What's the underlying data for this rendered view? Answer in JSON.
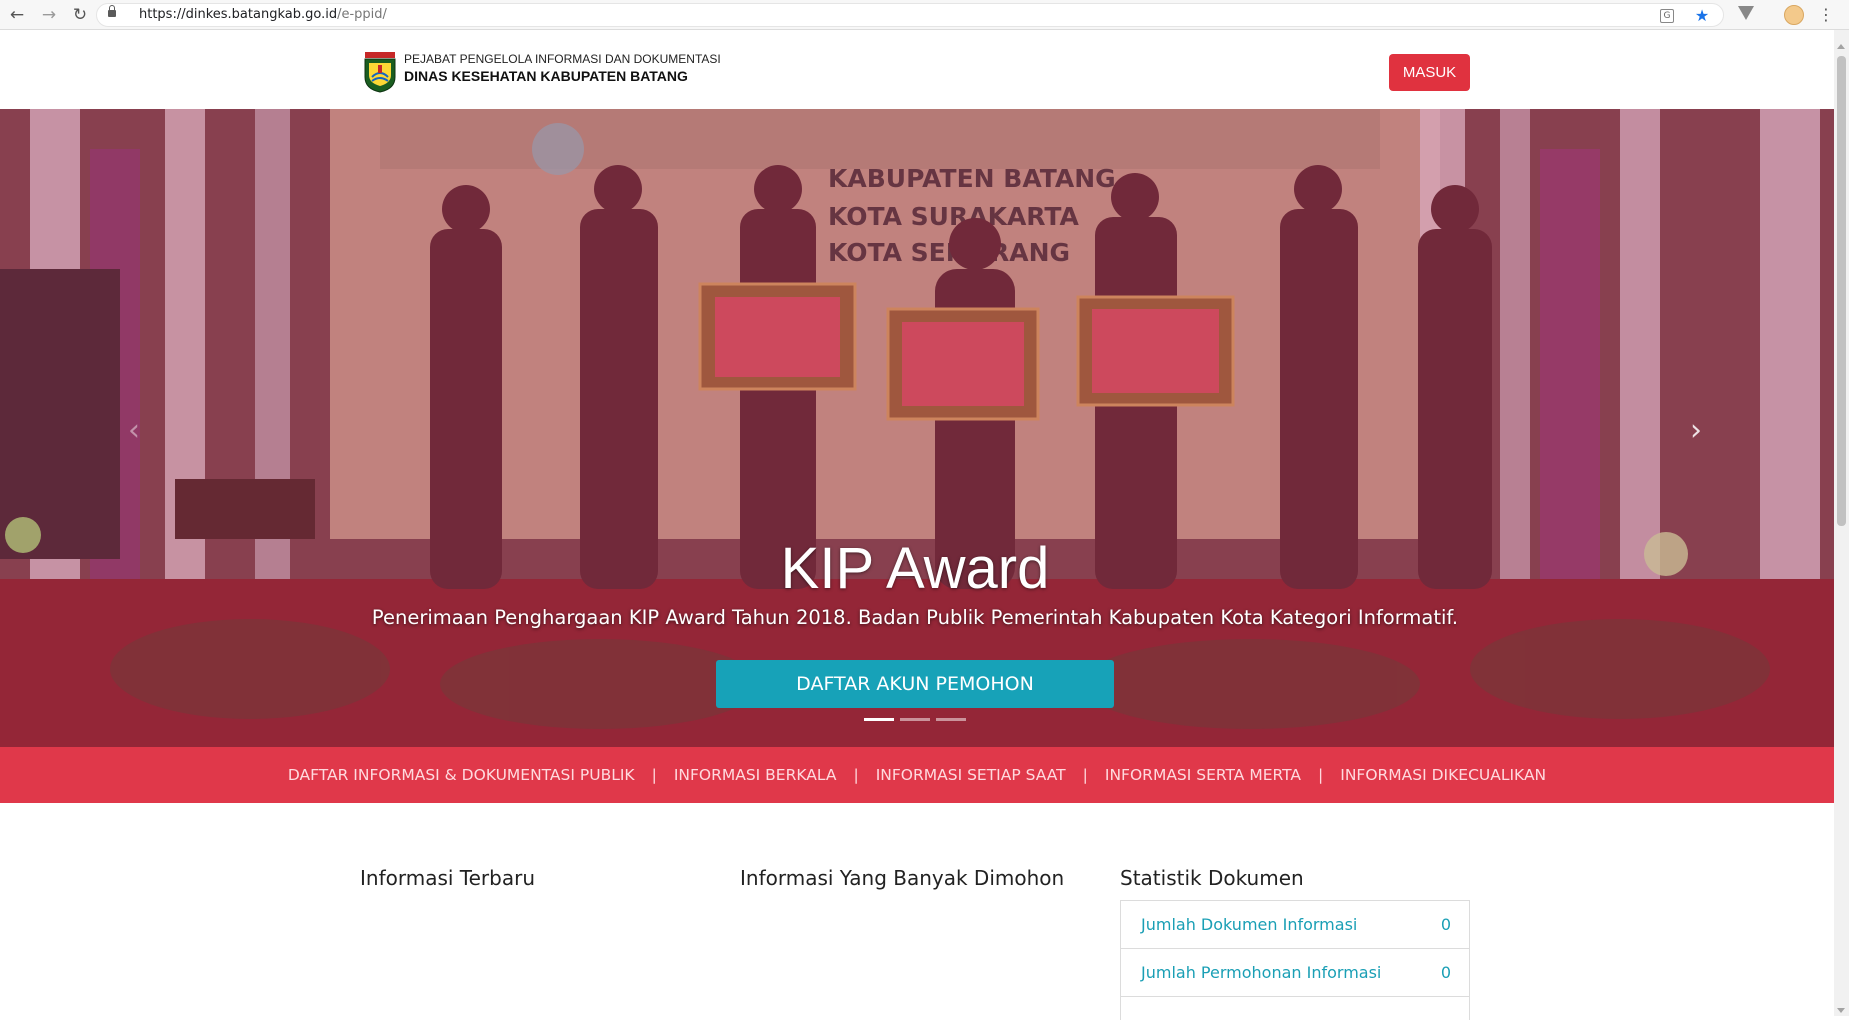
{
  "browser": {
    "url_host": "https://dinkes.batangkab.go.id",
    "url_path": "/e-ppid/",
    "back_glyph": "←",
    "forward_glyph": "→",
    "reload_glyph": "↻",
    "menu_glyph": "⋮",
    "star_glyph": "★",
    "translate_glyph": "G"
  },
  "header": {
    "brand_line1": "PEJABAT PENGELOLA INFORMASI DAN DOKUMENTASI",
    "brand_line2": "DINAS KESEHATAN KABUPATEN BATANG",
    "login_label": "MASUK"
  },
  "hero": {
    "title": "KIP Award",
    "subtitle": "Penerimaan Penghargaan KIP Award Tahun 2018. Badan Publik Pemerintah Kabupaten Kota Kategori Informatif.",
    "button_label": "DAFTAR AKUN PEMOHON",
    "prev_glyph": "‹",
    "next_glyph": "›",
    "slide_count": 3,
    "active_slide": 1
  },
  "category_nav": {
    "items": [
      "DAFTAR INFORMASI & DOKUMENTASI PUBLIK",
      "INFORMASI BERKALA",
      "INFORMASI SETIAP SAAT",
      "INFORMASI SERTA MERTA",
      "INFORMASI DIKECUALIKAN"
    ],
    "separator": "|"
  },
  "sections": {
    "latest_title": "Informasi Terbaru",
    "popular_title": "Informasi Yang Banyak Dimohon",
    "stats_title": "Statistik Dokumen"
  },
  "stats": [
    {
      "label": "Jumlah Dokumen Informasi",
      "value": "0"
    },
    {
      "label": "Jumlah Permohonan Informasi",
      "value": "0"
    }
  ],
  "colors": {
    "accent_red": "#e0323f",
    "nav_red": "#e0384a",
    "teal": "#17a2b8"
  },
  "icons": {
    "lock": "lock-icon",
    "extension": "extension-icon",
    "profile": "profile-avatar-icon"
  }
}
